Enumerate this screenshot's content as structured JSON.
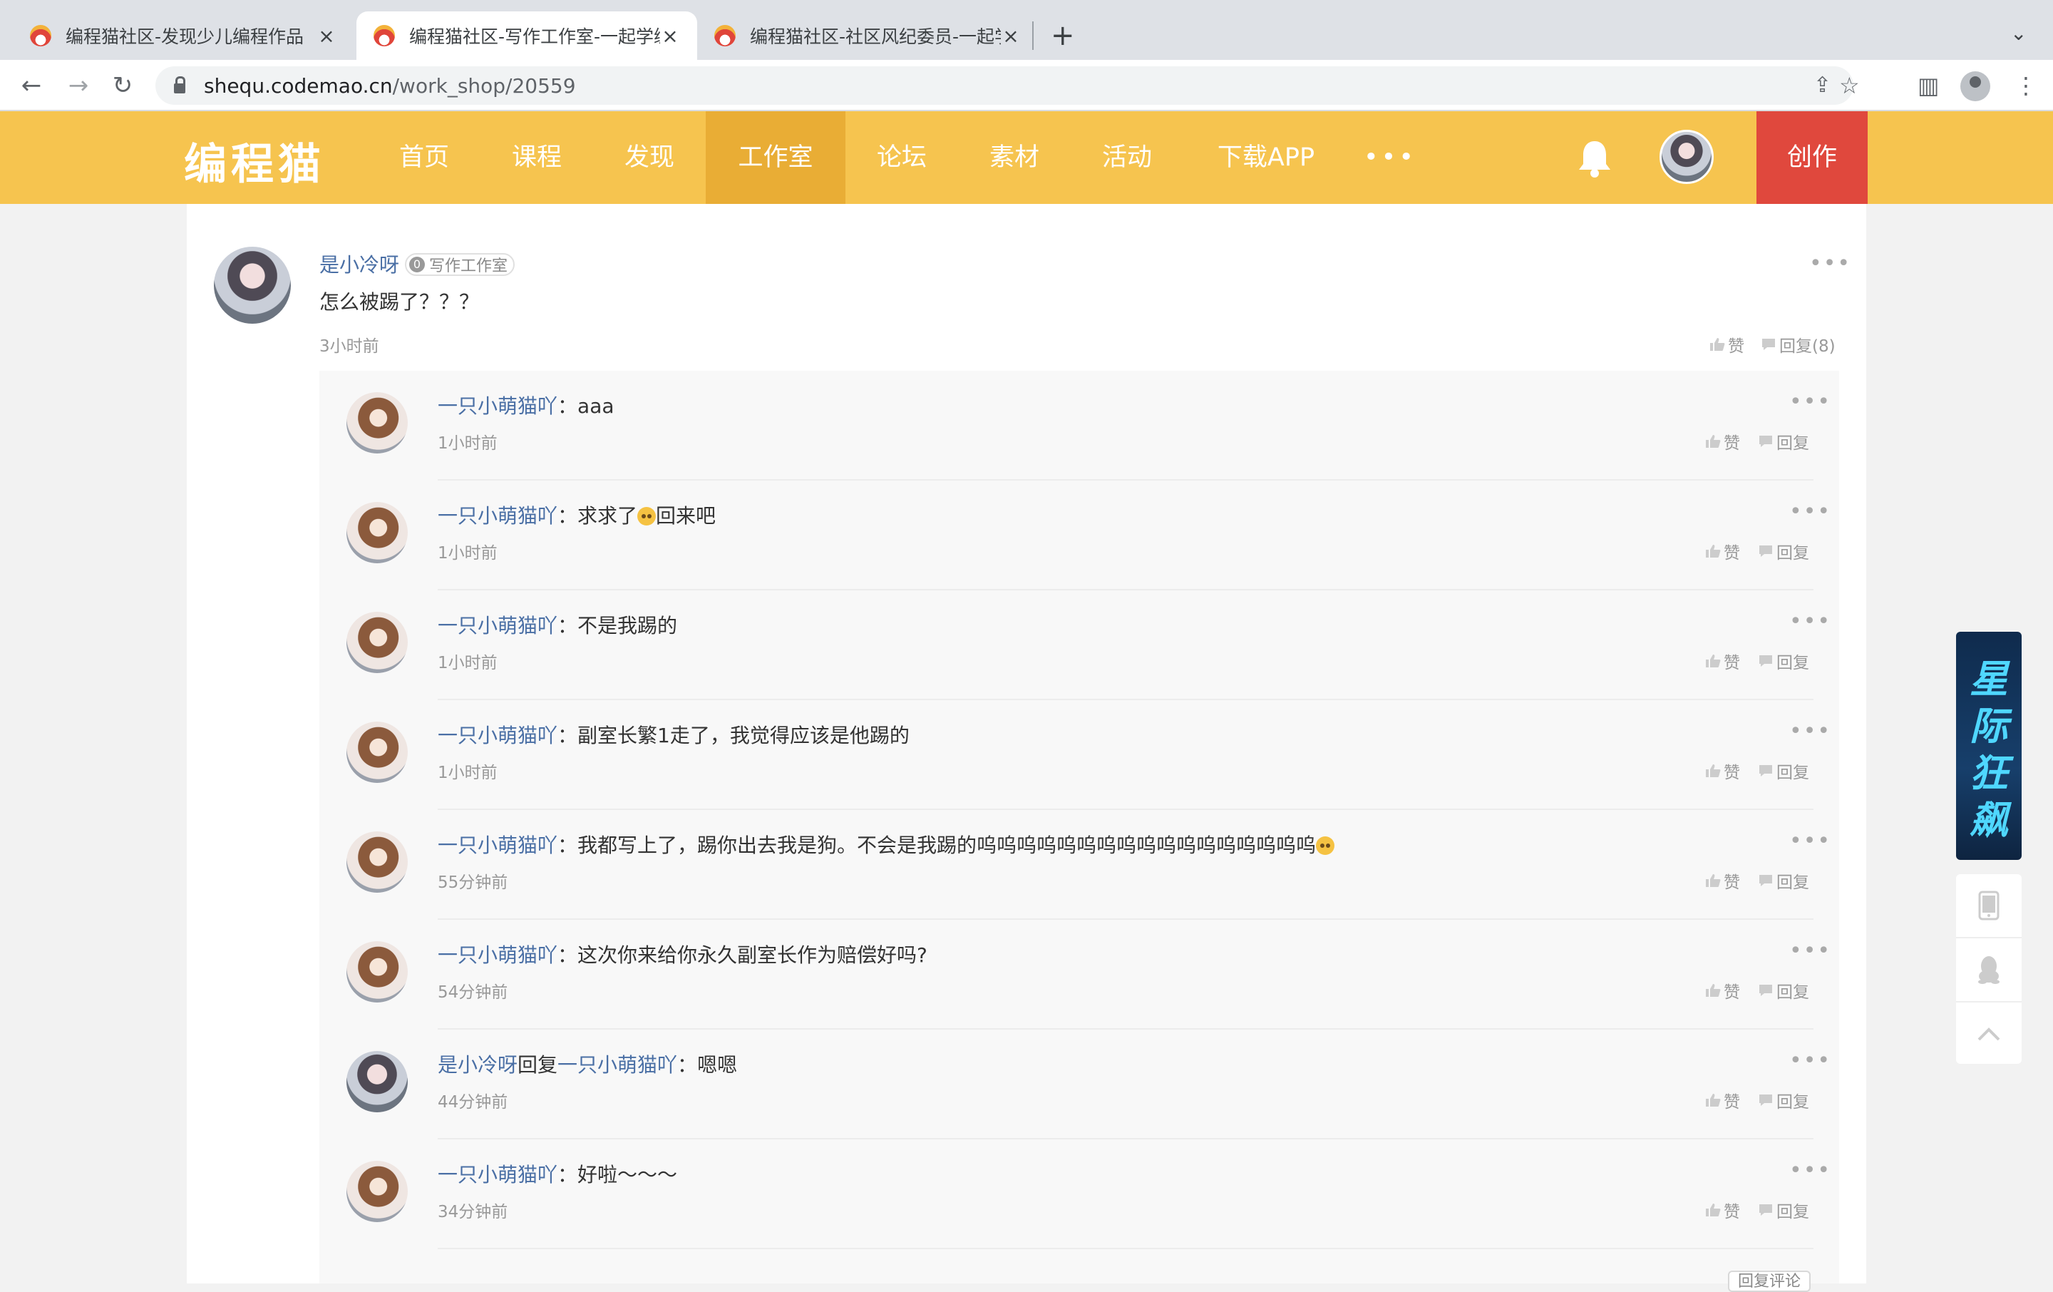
{
  "browser": {
    "tabs": [
      {
        "title": "编程猫社区-发现少儿编程作品",
        "active": false
      },
      {
        "title": "编程猫社区-写作工作室-一起学编",
        "active": true
      },
      {
        "title": "编程猫社区-社区风纪委员-一起学",
        "active": false
      }
    ],
    "url_host": "shequ.codemao.cn",
    "url_path": "/work_shop/20559"
  },
  "site": {
    "logo": "编程猫",
    "nav": [
      "首页",
      "课程",
      "发现",
      "工作室",
      "论坛",
      "素材",
      "活动",
      "下载APP"
    ],
    "active_nav": "工作室",
    "more": "•••",
    "create_label": "创作"
  },
  "post": {
    "author": "是小冷呀",
    "badge_level": "0",
    "badge_label": "写作工作室",
    "text": "怎么被踢了？？？",
    "time": "3小时前",
    "like_label": "赞",
    "reply_label": "回复(8)"
  },
  "replies": [
    {
      "author": "一只小萌猫吖",
      "to": "",
      "text": "aaa",
      "emoji": false,
      "time": "1小时前",
      "avatar": "cat"
    },
    {
      "author": "一只小萌猫吖",
      "to": "",
      "text": "求求了",
      "emoji": true,
      "text_after": "回来吧",
      "time": "1小时前",
      "avatar": "cat"
    },
    {
      "author": "一只小萌猫吖",
      "to": "",
      "text": "不是我踢的",
      "emoji": false,
      "time": "1小时前",
      "avatar": "cat"
    },
    {
      "author": "一只小萌猫吖",
      "to": "",
      "text": "副室长繁1走了，我觉得应该是他踢的",
      "emoji": false,
      "time": "1小时前",
      "avatar": "cat"
    },
    {
      "author": "一只小萌猫吖",
      "to": "",
      "text": "我都写上了，踢你出去我是狗。不会是我踢的呜呜呜呜呜呜呜呜呜呜呜呜呜呜呜呜呜",
      "emoji": true,
      "text_after": "",
      "time": "55分钟前",
      "avatar": "cat"
    },
    {
      "author": "一只小萌猫吖",
      "to": "",
      "text": "这次你来给你永久副室长作为赔偿好吗?",
      "emoji": false,
      "time": "54分钟前",
      "avatar": "cat"
    },
    {
      "author": "是小冷呀",
      "to": "一只小萌猫吖",
      "text": "嗯嗯",
      "emoji": false,
      "time": "44分钟前",
      "avatar": "girl"
    },
    {
      "author": "一只小萌猫吖",
      "to": "",
      "text": "好啦～～～",
      "emoji": false,
      "time": "34分钟前",
      "avatar": "cat"
    }
  ],
  "reply_labels": {
    "like": "赞",
    "reply": "回复",
    "reply_to": "回复",
    "colon": "："
  },
  "bottom_button": "回复评论",
  "side_banner": "星际狂飙",
  "colors": {
    "brand": "#f6c44f",
    "brand_active": "#e9ad35",
    "create": "#e0483d",
    "link": "#4a6fa5"
  }
}
